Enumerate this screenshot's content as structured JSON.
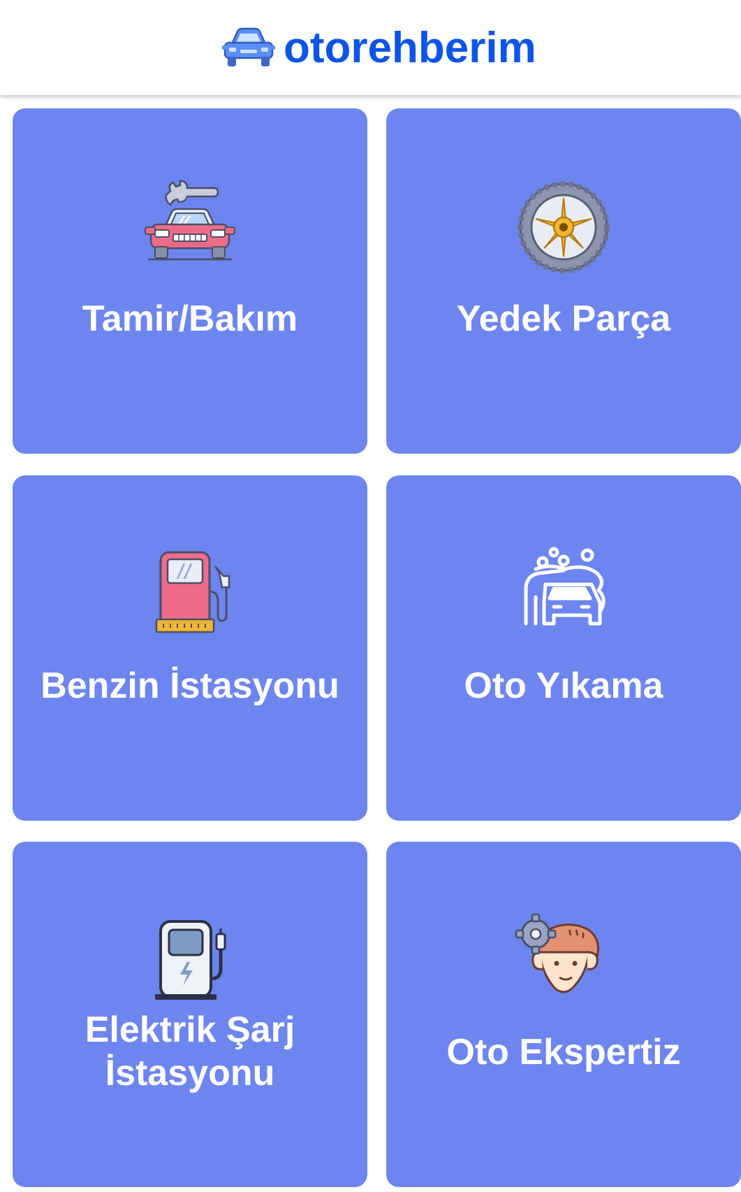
{
  "header": {
    "brand_name": "otorehberim",
    "brand_icon": "car-icon",
    "brand_color": "#0d55e8"
  },
  "tiles": [
    {
      "label": "Tamir/Bakım",
      "icon": "car-repair-icon"
    },
    {
      "label": "Yedek Parça",
      "icon": "tire-icon"
    },
    {
      "label": "Benzin İstasyonu",
      "icon": "fuel-pump-icon"
    },
    {
      "label": "Oto Yıkama",
      "icon": "car-wash-icon"
    },
    {
      "label_lines": [
        "Elektrik Şarj",
        "İstasyonu"
      ],
      "icon": "ev-charger-icon"
    },
    {
      "label": "Oto Ekspertiz",
      "icon": "expert-gear-head-icon"
    }
  ],
  "colors": {
    "tile_background": "#6d85ee",
    "tile_text": "#ffffff",
    "page_background": "#ffffff"
  }
}
